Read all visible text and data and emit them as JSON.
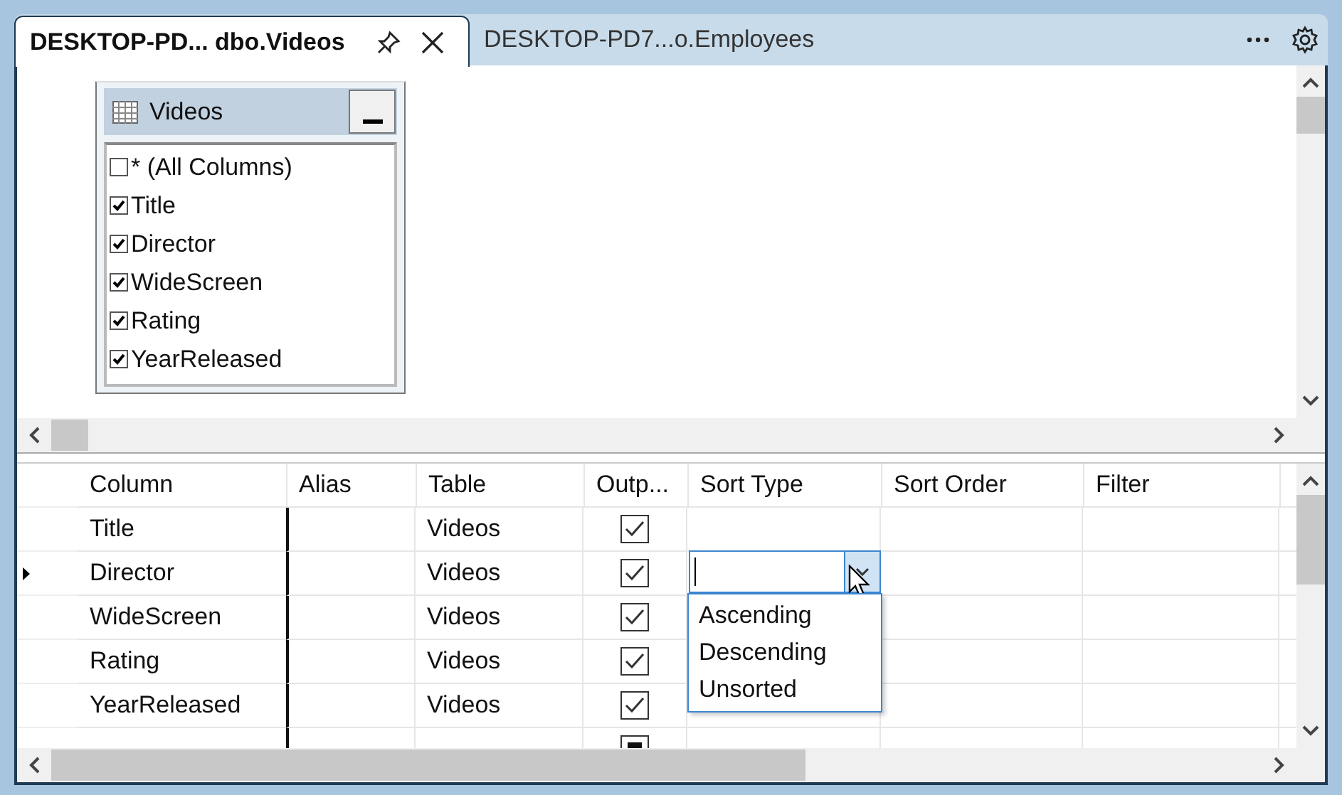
{
  "tabs": [
    {
      "label": "DESKTOP-PD... dbo.Videos",
      "selected": true
    },
    {
      "label": "DESKTOP-PD7...o.Employees",
      "selected": false
    }
  ],
  "diagram": {
    "table": {
      "title": "Videos",
      "columns": [
        {
          "label": "* (All Columns)",
          "checked": false
        },
        {
          "label": "Title",
          "checked": true
        },
        {
          "label": "Director",
          "checked": true
        },
        {
          "label": "WideScreen",
          "checked": true
        },
        {
          "label": "Rating",
          "checked": true
        },
        {
          "label": "YearReleased",
          "checked": true
        }
      ]
    }
  },
  "grid": {
    "columns": [
      "Column",
      "Alias",
      "Table",
      "Outp...",
      "Sort Type",
      "Sort Order",
      "Filter"
    ],
    "rows": [
      {
        "kind": "field",
        "column": "Title",
        "table": "Videos",
        "output": true,
        "current": false
      },
      {
        "kind": "field",
        "column": "Director",
        "table": "Videos",
        "output": true,
        "current": true
      },
      {
        "kind": "field",
        "column": "WideScreen",
        "table": "Videos",
        "output": true,
        "current": false
      },
      {
        "kind": "field",
        "column": "Rating",
        "table": "Videos",
        "output": true,
        "current": false
      },
      {
        "kind": "field",
        "column": "YearReleased",
        "table": "Videos",
        "output": true,
        "current": false
      },
      {
        "kind": "new",
        "indeterminate": true
      }
    ],
    "sort_dropdown": {
      "options": [
        "Ascending",
        "Descending",
        "Unsorted"
      ]
    }
  }
}
